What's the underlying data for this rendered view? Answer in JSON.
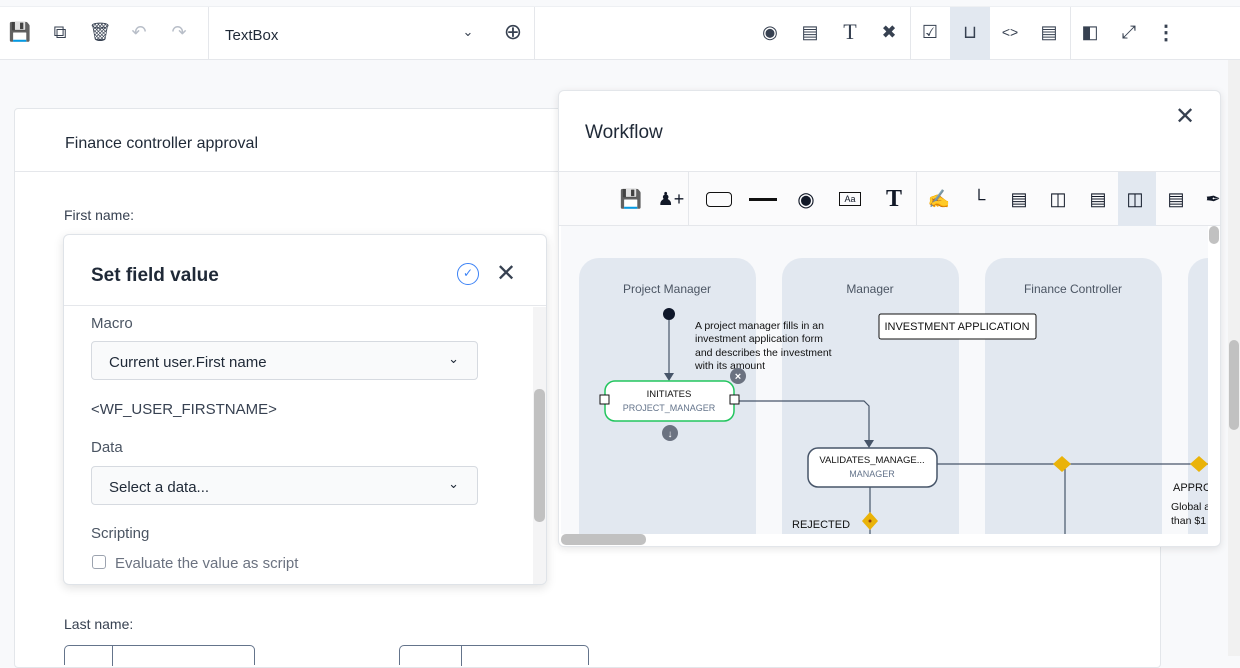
{
  "toolbar": {
    "left_icons": [
      "save-icon",
      "copy-icon",
      "trash-icon",
      "undo-icon",
      "redo-icon"
    ],
    "field_select": "TextBox",
    "right_icons": [
      "preview-icon",
      "form-icon",
      "text-icon",
      "design-tools-icon",
      "checklist-icon",
      "workflow-plug-icon",
      "code-file-icon",
      "script-icon",
      "theme-icon",
      "fullscreen-icon",
      "more-icon"
    ],
    "active": "workflow-plug-icon",
    "accent": "#e2e8f0"
  },
  "card": {
    "title": "Finance controller approval",
    "first_name_label": "First name:",
    "last_name_label": "Last name:"
  },
  "popover": {
    "title": "Set field value",
    "macro_label": "Macro",
    "macro_value": "Current user.First name",
    "macro_token": "<WF_USER_FIRSTNAME>",
    "data_label": "Data",
    "data_placeholder": "Select a data...",
    "scripting_label": "Scripting",
    "evaluate_label": "Evaluate the value as script",
    "evaluate_checked": false
  },
  "workflow": {
    "title": "Workflow",
    "tools": [
      "save-icon",
      "add-user-icon",
      "rectangle-icon",
      "line-icon",
      "radio-icon",
      "label-icon",
      "text-icon",
      "draw-icon",
      "connector-icon",
      "header-icon",
      "columns-icon",
      "rows-icon",
      "vertical-lanes-icon",
      "horizontal-lanes-icon",
      "eyedropper-icon"
    ],
    "active_tool": "vertical-lanes-icon",
    "lanes": [
      "Project Manager",
      "Manager",
      "Finance Controller"
    ],
    "note": [
      "A project manager fills in an",
      "investment application form",
      "and describes the investment",
      "with its amount"
    ],
    "title_box": "INVESTMENT APPLICATION",
    "nodes": [
      {
        "name": "INITIATES",
        "role": "PROJECT_MANAGER",
        "selected": true
      },
      {
        "name": "VALIDATES_MANAGE...",
        "role": "MANAGER"
      }
    ],
    "labels": {
      "rejected": "REJECTED",
      "approved": "APPRO",
      "condition1": "Global a",
      "condition2": "than $1"
    },
    "colors": {
      "lane": "#e2e8f0",
      "selected": "#22c55e",
      "gateway": "#eab308"
    }
  }
}
